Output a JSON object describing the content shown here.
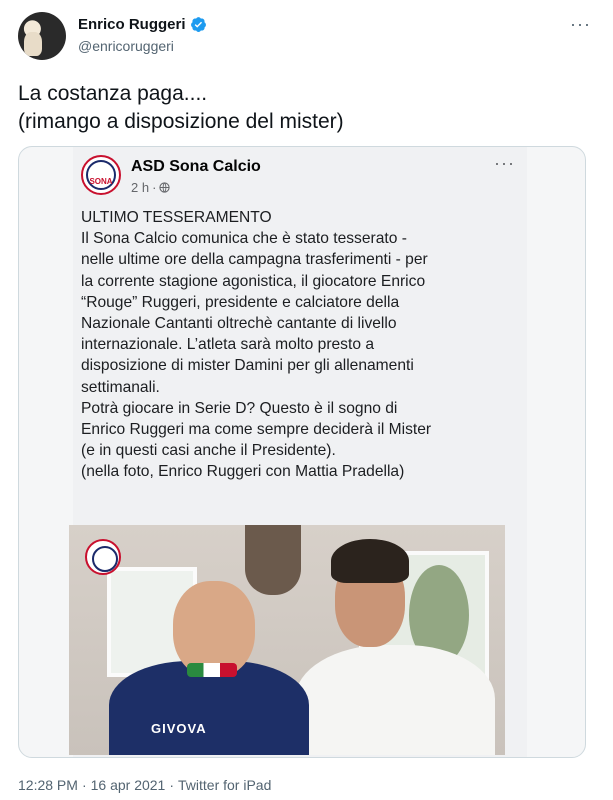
{
  "author": {
    "display_name": "Enrico Ruggeri",
    "handle": "@enricoruggeri",
    "verified": true,
    "avatar_icon": "avatar-photo"
  },
  "more_icon": "···",
  "tweet": {
    "lines": [
      "La costanza paga....",
      "(rimango a disposizione del mister)"
    ]
  },
  "embedded_post": {
    "page_name": "ASD Sona Calcio",
    "page_logo_text": "SONA",
    "time": "2 h",
    "separator": "·",
    "privacy_icon": "globe-icon",
    "more_icon": "···",
    "text_lines": [
      "ULTIMO TESSERAMENTO",
      "Il Sona Calcio comunica che è stato tesserato -",
      "nelle ultime ore della campagna trasferimenti -  per",
      "la corrente stagione agonistica, il giocatore  Enrico",
      "“Rouge” Ruggeri, presidente e calciatore della",
      "Nazionale Cantanti oltrechè cantante di livello",
      "internazionale. L’atleta sarà molto presto a",
      "disposizione di mister Damini per gli allenamenti",
      "settimanali.",
      "Potrà giocare in Serie D? Questo è il sogno di",
      "Enrico Ruggeri ma come sempre deciderà il Mister",
      "(e in questi casi anche il Presidente).",
      "(nella foto, Enrico Ruggeri con Mattia Pradella)"
    ],
    "photo_brand_text": "GIVOVA"
  },
  "footer": {
    "time": "12:28 PM",
    "separator": "·",
    "date": "16 apr 2021",
    "separator2": "·",
    "source": "Twitter for iPad"
  },
  "colors": {
    "verified_blue": "#1d9bf0",
    "text_primary": "#0f1419",
    "text_secondary": "#536471",
    "border": "#cfd9de"
  }
}
